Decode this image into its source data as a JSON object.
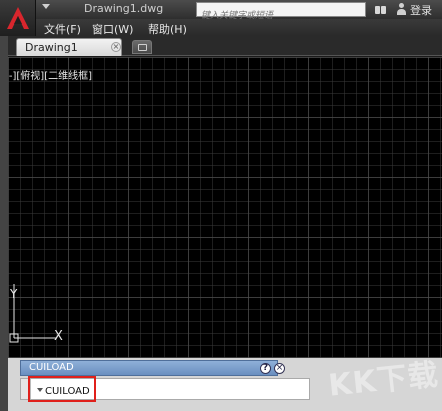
{
  "title_bar": {
    "doc_title": "Drawing1.dwg",
    "search_placeholder": "键入关键字或短语",
    "login_label": "登录"
  },
  "menu": {
    "items": [
      "文件(F)",
      "窗口(W)",
      "帮助(H)"
    ]
  },
  "tabs": {
    "active_label": "Drawing1"
  },
  "canvas": {
    "viewport_controls": "[-][俯视][二维线框]",
    "ucs_x_label": "X",
    "ucs_y_label": "Y"
  },
  "command_window": {
    "title": "CUILOAD",
    "input_value": "CUILOAD",
    "help_glyph": "?",
    "close_glyph": "×"
  },
  "watermark": {
    "text": "KK下载"
  },
  "colors": {
    "highlight": "#e0201b",
    "canvas_bg": "#000000"
  }
}
